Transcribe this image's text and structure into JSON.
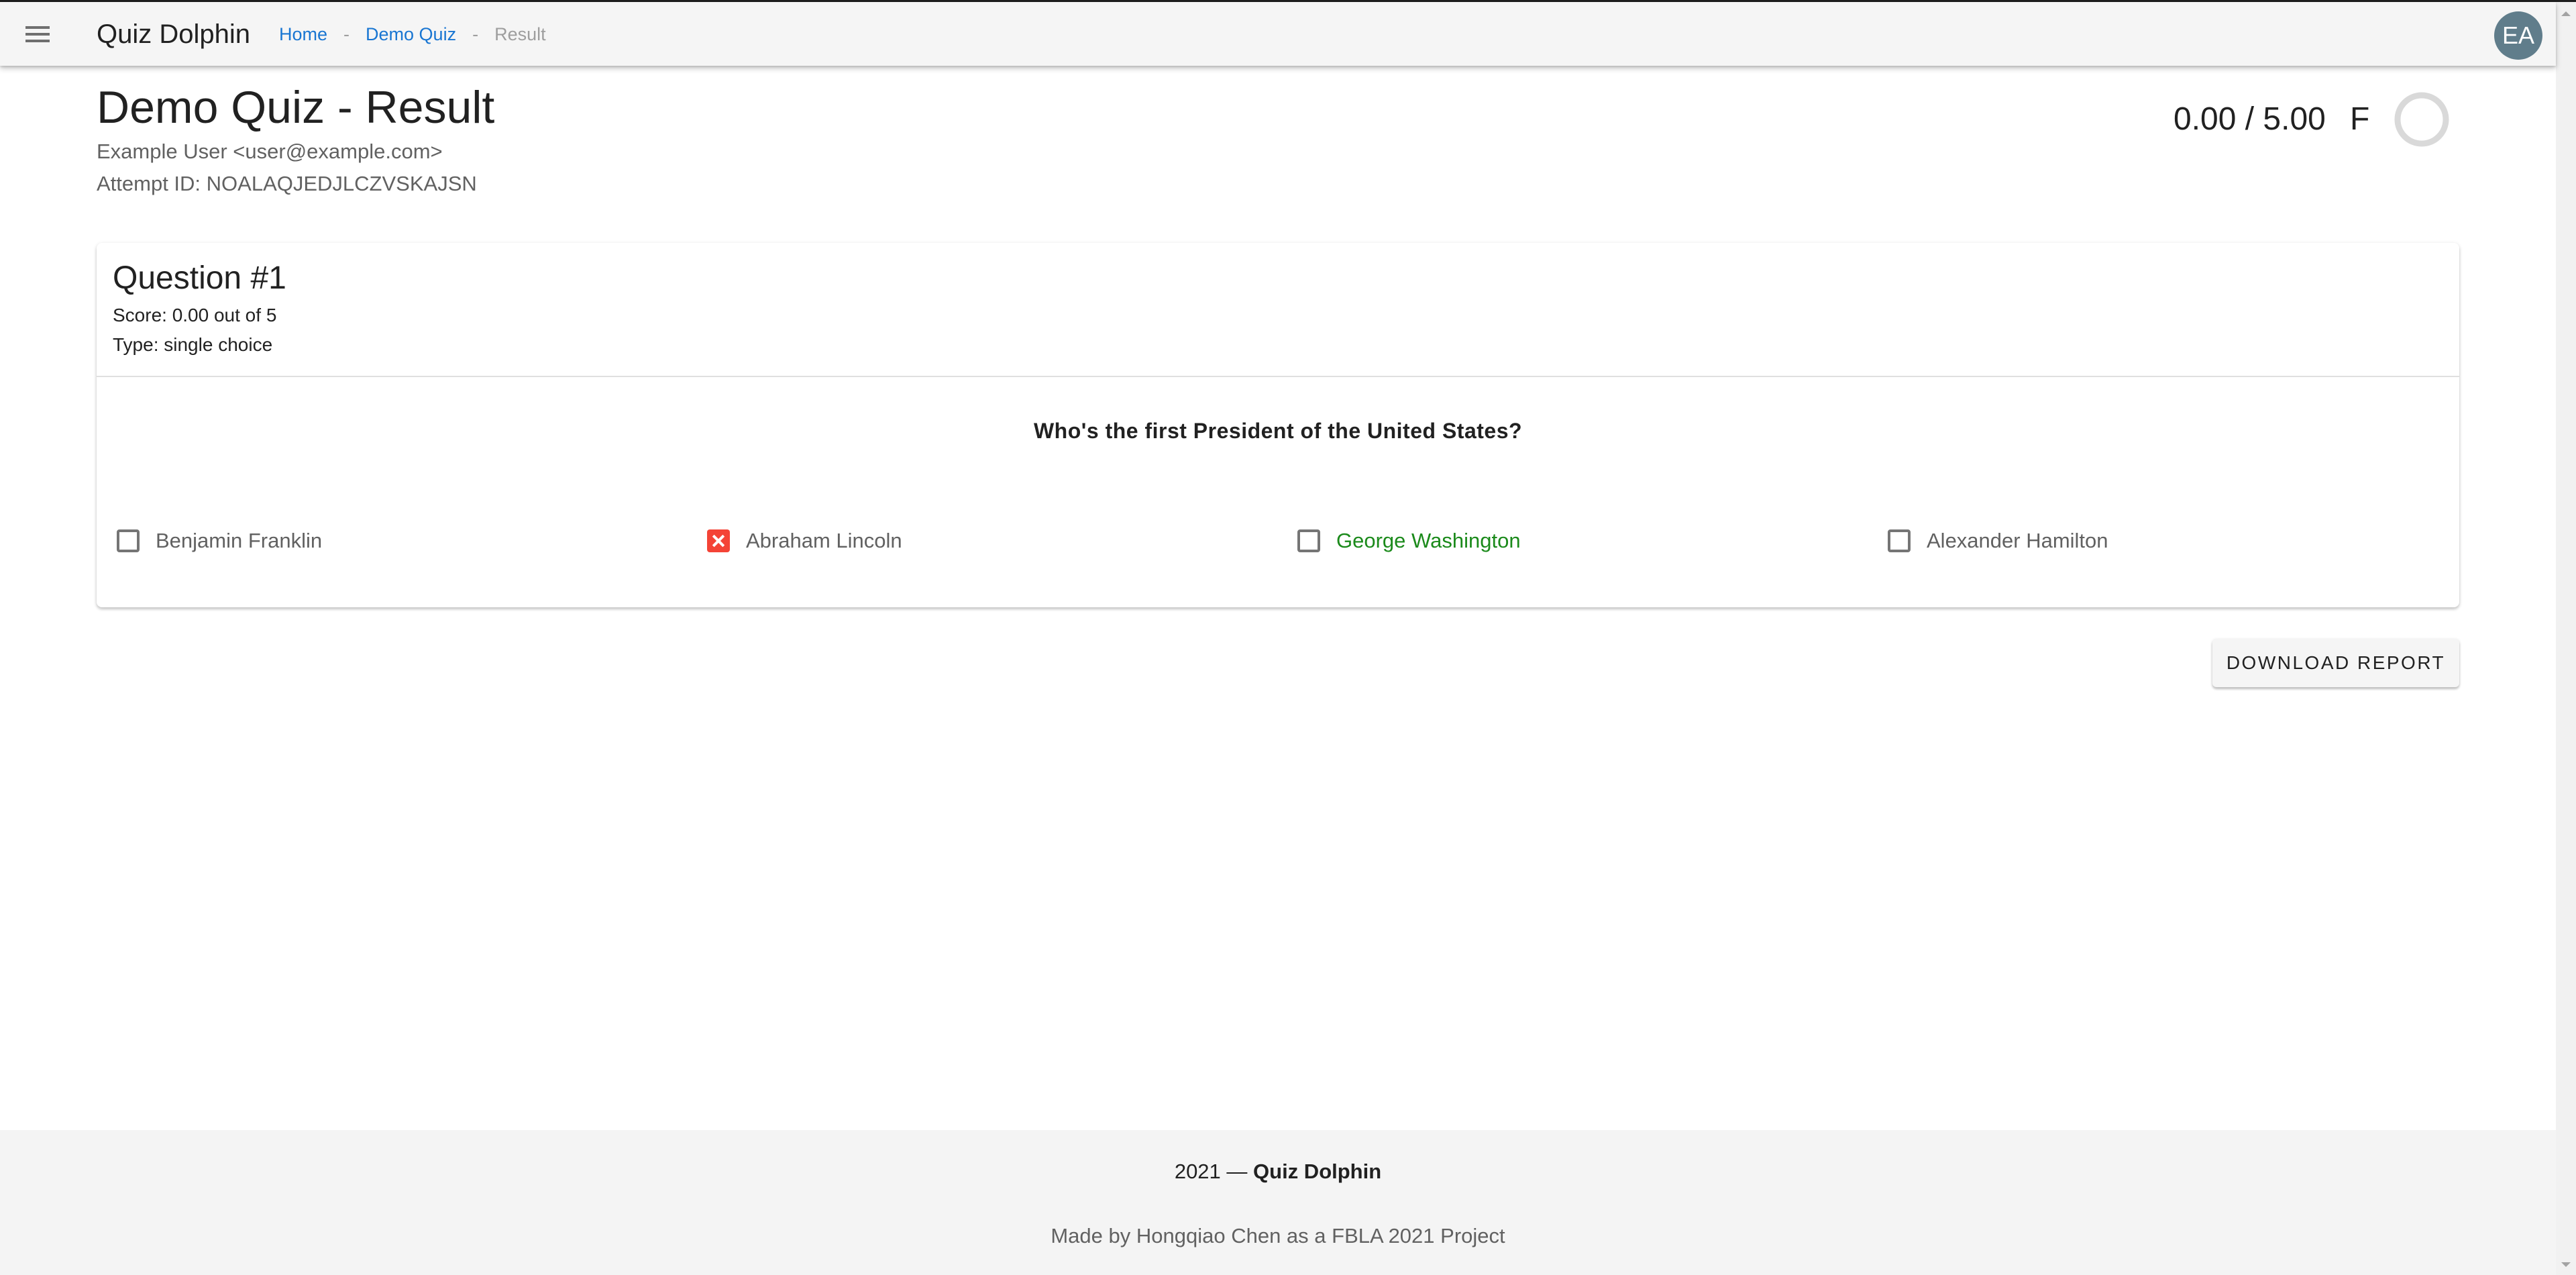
{
  "app": {
    "title": "Quiz Dolphin",
    "avatar_initials": "EA",
    "avatar_color": "#607d8b"
  },
  "breadcrumb": {
    "items": [
      {
        "label": "Home",
        "link": true
      },
      {
        "label": "Demo Quiz",
        "link": true
      },
      {
        "label": "Result",
        "link": false
      }
    ],
    "separator": "-"
  },
  "result": {
    "title": "Demo Quiz - Result",
    "user": "Example User <user@example.com>",
    "attempt": "Attempt ID: NOALAQJEDJLCZVSKAJSN",
    "score_text": "0.00 / 5.00",
    "grade": "F",
    "score_fraction": 0.0
  },
  "questions": [
    {
      "title": "Question #1",
      "score": "Score: 0.00 out of 5",
      "type": "Type: single choice",
      "text": "Who's the first President of the United States?",
      "options": [
        {
          "label": "Benjamin Franklin",
          "state": "unselected"
        },
        {
          "label": "Abraham Lincoln",
          "state": "selected-wrong"
        },
        {
          "label": "George Washington",
          "state": "correct-answer"
        },
        {
          "label": "Alexander Hamilton",
          "state": "unselected"
        }
      ]
    }
  ],
  "actions": {
    "download_report": "Download Report"
  },
  "footer": {
    "year": "2021 —",
    "brand": "Quiz Dolphin",
    "credit": "Made by Hongqiao Chen as a FBLA 2021 Project"
  },
  "colors": {
    "link": "#1976d2",
    "wrong": "#f44336",
    "correct": "#1b8a1b",
    "ring_track": "#d9d9d9"
  }
}
